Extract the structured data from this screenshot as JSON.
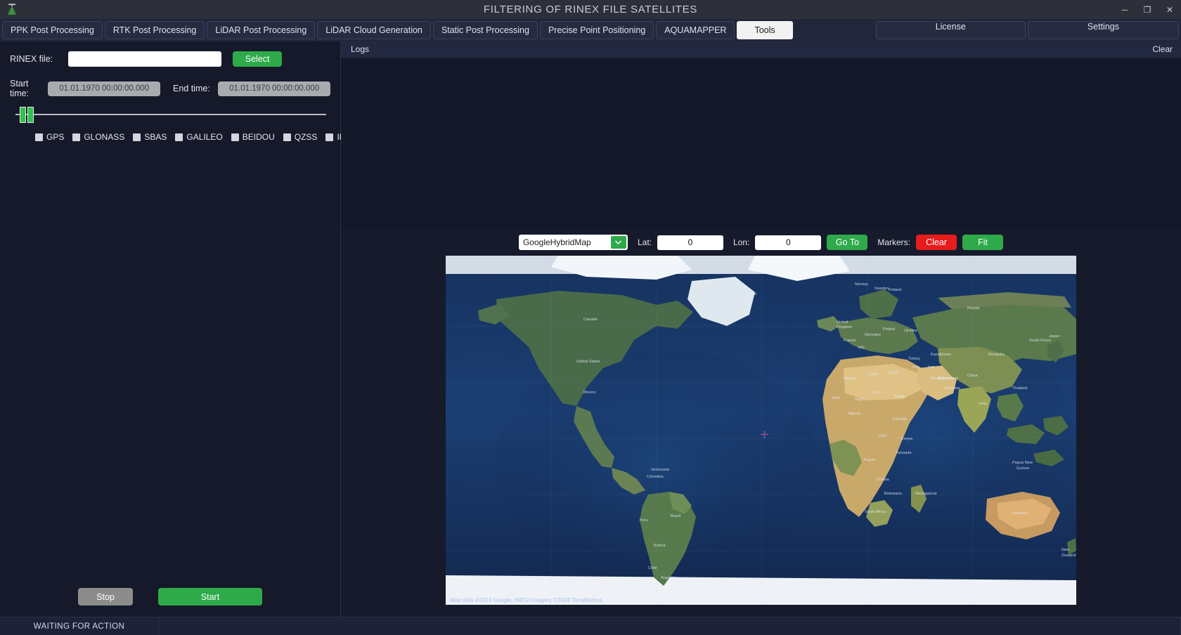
{
  "window": {
    "title": "FILTERING OF RINEX FILE SATELLITES",
    "logo_icon": "antenna-tripod-logo",
    "minimize_icon": "minimize-icon",
    "maximize_icon": "maximize-icon",
    "close_icon": "close-icon",
    "minimize_glyph": "─",
    "maximize_glyph": "❐",
    "close_glyph": "✕"
  },
  "tabs": {
    "items": [
      {
        "label": "PPK Post Processing",
        "active": false
      },
      {
        "label": "RTK Post Processing",
        "active": false
      },
      {
        "label": "LiDAR Post Processing",
        "active": false
      },
      {
        "label": "LiDAR Cloud Generation",
        "active": false
      },
      {
        "label": "Static Post Processing",
        "active": false
      },
      {
        "label": "Precise Point Positioning",
        "active": false
      },
      {
        "label": "AQUAMAPPER",
        "active": false
      },
      {
        "label": "Tools",
        "active": true
      }
    ],
    "right_items": [
      {
        "label": "License"
      },
      {
        "label": "Settings"
      }
    ]
  },
  "form": {
    "rinex_label": "RINEX file:",
    "rinex_value": "",
    "rinex_placeholder": "",
    "select_label": "Select",
    "start_time_label": "Start time:",
    "start_time_value": "01.01.1970 00:00:00.000",
    "end_time_label": "End time:",
    "end_time_value": "01.01.1970 00:00:00.000",
    "constellations": [
      {
        "label": "GPS",
        "checked": false
      },
      {
        "label": "GLONASS",
        "checked": false
      },
      {
        "label": "SBAS",
        "checked": false
      },
      {
        "label": "GALILEO",
        "checked": false
      },
      {
        "label": "BEIDOU",
        "checked": false
      },
      {
        "label": "QZSS",
        "checked": false
      },
      {
        "label": "IRNSS",
        "checked": false
      }
    ],
    "stop_label": "Stop",
    "start_label": "Start"
  },
  "logs": {
    "title": "Logs",
    "clear_label": "Clear",
    "entries": []
  },
  "map": {
    "provider_value": "GoogleHybridMap",
    "provider_options": [
      "GoogleHybridMap"
    ],
    "dropdown_icon": "chevron-down-icon",
    "lat_label": "Lat:",
    "lat_value": "0",
    "lon_label": "Lon:",
    "lon_value": "0",
    "goto_label": "Go To",
    "markers_label": "Markers:",
    "markers_clear_label": "Clear",
    "fit_label": "Fit",
    "attribution": "Map data ©2024 Google, INEGI  Imagery ©2024 TerraMetrics",
    "marker_icon": "map-pin-marker"
  },
  "status": {
    "action": "WAITING FOR ACTION",
    "secondary": ""
  },
  "colors": {
    "accent_green": "#2eaa4a",
    "danger_red": "#e81c1c",
    "neutral_gray": "#8c8c8c",
    "titlebar": "#2e3039",
    "panel_bg": "#151929"
  }
}
